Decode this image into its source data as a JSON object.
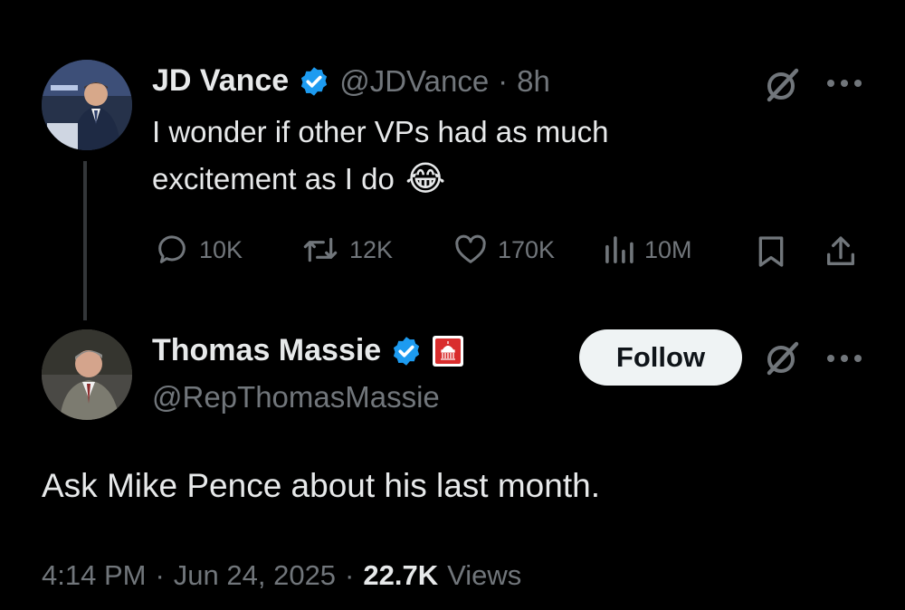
{
  "tweet": {
    "author_name": "JD Vance",
    "author_handle": "@JDVance",
    "separator": "·",
    "time": "8h",
    "text_line1": "I wonder if other VPs had as much",
    "text_line2": "excitement as I do",
    "emoji": "😂",
    "stats": {
      "replies": "10K",
      "reposts": "12K",
      "likes": "170K",
      "views": "10M"
    }
  },
  "reply": {
    "author_name": "Thomas Massie",
    "author_handle": "@RepThomasMassie",
    "follow_label": "Follow",
    "text": "Ask Mike Pence about his last month.",
    "footer_time": "4:14 PM",
    "footer_sep1": "·",
    "footer_date": "Jun 24, 2025",
    "footer_sep2": "·",
    "footer_views_count": "22.7K",
    "footer_views_label": "Views"
  },
  "colors": {
    "background": "#000000",
    "text_primary": "#e7e9ea",
    "text_secondary": "#71767b",
    "verified_badge": "#1d9bf0",
    "government_badge": "#d92d2d",
    "follow_button_bg": "#eff3f4"
  },
  "icons": [
    "verified-badge-icon",
    "grok-icon",
    "more-icon",
    "reply-icon",
    "repost-icon",
    "like-icon",
    "views-icon",
    "bookmark-icon",
    "share-icon",
    "government-badge-icon"
  ]
}
